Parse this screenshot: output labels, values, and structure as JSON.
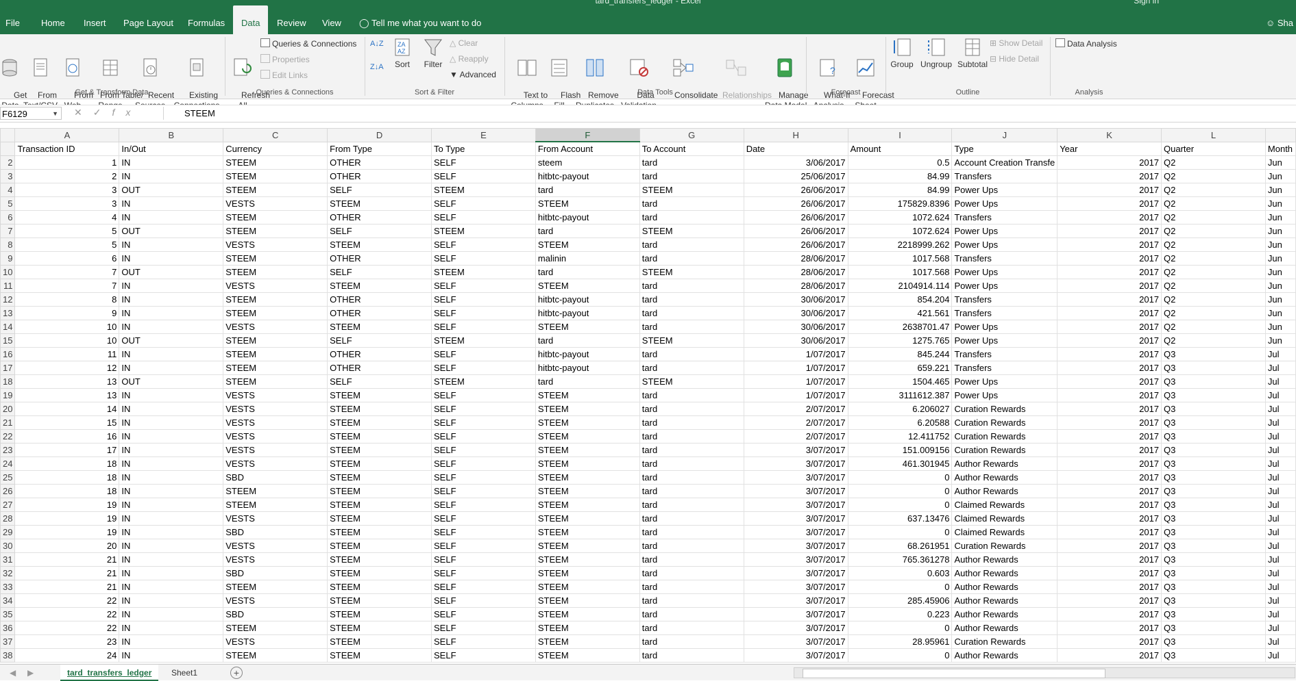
{
  "window": {
    "title": "tard_transfers_ledger  -  Excel",
    "sign_in": "Sign in",
    "share": "Sha"
  },
  "tabs": [
    "File",
    "Home",
    "Insert",
    "Page Layout",
    "Formulas",
    "Data",
    "Review",
    "View"
  ],
  "active_tab": "Data",
  "tell_me": "Tell me what you want to do",
  "ribbon": {
    "get_transform": {
      "label": "Get & Transform Data",
      "get_data": "Get\nData",
      "from_text": "From\nText/CSV",
      "from_web": "From\nWeb",
      "from_table": "From Table/\nRange",
      "recent_sources": "Recent\nSources",
      "existing_connections": "Existing\nConnections"
    },
    "queries": {
      "label": "Queries & Connections",
      "refresh_all": "Refresh\nAll",
      "queries_connections": "Queries & Connections",
      "properties": "Properties",
      "edit_links": "Edit Links"
    },
    "sort_filter": {
      "label": "Sort & Filter",
      "sort": "Sort",
      "filter": "Filter",
      "clear": "Clear",
      "reapply": "Reapply",
      "advanced": "Advanced"
    },
    "data_tools": {
      "label": "Data Tools",
      "text_to_columns": "Text to\nColumns",
      "flash_fill": "Flash\nFill",
      "remove_duplicates": "Remove\nDuplicates",
      "data_validation": "Data\nValidation",
      "consolidate": "Consolidate",
      "relationships": "Relationships",
      "manage_data_model": "Manage\nData Model"
    },
    "forecast": {
      "label": "Forecast",
      "what_if": "What-If\nAnalysis",
      "forecast_sheet": "Forecast\nSheet"
    },
    "outline": {
      "label": "Outline",
      "group": "Group",
      "ungroup": "Ungroup",
      "subtotal": "Subtotal",
      "show_detail": "Show Detail",
      "hide_detail": "Hide Detail"
    },
    "analysis": {
      "label": "Analysis",
      "data_analysis": "Data Analysis"
    }
  },
  "formula_bar": {
    "name_box": "F6129",
    "formula": "STEEM"
  },
  "columns": [
    "A",
    "B",
    "C",
    "D",
    "E",
    "F",
    "G",
    "H",
    "I",
    "J",
    "K",
    "L"
  ],
  "selected_column": "F",
  "headers": [
    "Transaction ID",
    "In/Out",
    "Currency",
    "From Type",
    "To Type",
    "From Account",
    "To Account",
    "Date",
    "Amount",
    "Type",
    "Year",
    "Quarter",
    "Month"
  ],
  "rows": [
    [
      "2",
      "1",
      "IN",
      "STEEM",
      "OTHER",
      "SELF",
      "steem",
      "tard",
      "3/06/2017",
      "0.5",
      "Account Creation Transfe",
      "2017",
      "Q2",
      "Jun"
    ],
    [
      "3",
      "2",
      "IN",
      "STEEM",
      "OTHER",
      "SELF",
      "hitbtc-payout",
      "tard",
      "25/06/2017",
      "84.99",
      "Transfers",
      "2017",
      "Q2",
      "Jun"
    ],
    [
      "4",
      "3",
      "OUT",
      "STEEM",
      "SELF",
      "STEEM",
      "tard",
      "STEEM",
      "26/06/2017",
      "84.99",
      "Power Ups",
      "2017",
      "Q2",
      "Jun"
    ],
    [
      "5",
      "3",
      "IN",
      "VESTS",
      "STEEM",
      "SELF",
      "STEEM",
      "tard",
      "26/06/2017",
      "175829.8396",
      "Power Ups",
      "2017",
      "Q2",
      "Jun"
    ],
    [
      "6",
      "4",
      "IN",
      "STEEM",
      "OTHER",
      "SELF",
      "hitbtc-payout",
      "tard",
      "26/06/2017",
      "1072.624",
      "Transfers",
      "2017",
      "Q2",
      "Jun"
    ],
    [
      "7",
      "5",
      "OUT",
      "STEEM",
      "SELF",
      "STEEM",
      "tard",
      "STEEM",
      "26/06/2017",
      "1072.624",
      "Power Ups",
      "2017",
      "Q2",
      "Jun"
    ],
    [
      "8",
      "5",
      "IN",
      "VESTS",
      "STEEM",
      "SELF",
      "STEEM",
      "tard",
      "26/06/2017",
      "2218999.262",
      "Power Ups",
      "2017",
      "Q2",
      "Jun"
    ],
    [
      "9",
      "6",
      "IN",
      "STEEM",
      "OTHER",
      "SELF",
      "malinin",
      "tard",
      "28/06/2017",
      "1017.568",
      "Transfers",
      "2017",
      "Q2",
      "Jun"
    ],
    [
      "10",
      "7",
      "OUT",
      "STEEM",
      "SELF",
      "STEEM",
      "tard",
      "STEEM",
      "28/06/2017",
      "1017.568",
      "Power Ups",
      "2017",
      "Q2",
      "Jun"
    ],
    [
      "11",
      "7",
      "IN",
      "VESTS",
      "STEEM",
      "SELF",
      "STEEM",
      "tard",
      "28/06/2017",
      "2104914.114",
      "Power Ups",
      "2017",
      "Q2",
      "Jun"
    ],
    [
      "12",
      "8",
      "IN",
      "STEEM",
      "OTHER",
      "SELF",
      "hitbtc-payout",
      "tard",
      "30/06/2017",
      "854.204",
      "Transfers",
      "2017",
      "Q2",
      "Jun"
    ],
    [
      "13",
      "9",
      "IN",
      "STEEM",
      "OTHER",
      "SELF",
      "hitbtc-payout",
      "tard",
      "30/06/2017",
      "421.561",
      "Transfers",
      "2017",
      "Q2",
      "Jun"
    ],
    [
      "14",
      "10",
      "IN",
      "VESTS",
      "STEEM",
      "SELF",
      "STEEM",
      "tard",
      "30/06/2017",
      "2638701.47",
      "Power Ups",
      "2017",
      "Q2",
      "Jun"
    ],
    [
      "15",
      "10",
      "OUT",
      "STEEM",
      "SELF",
      "STEEM",
      "tard",
      "STEEM",
      "30/06/2017",
      "1275.765",
      "Power Ups",
      "2017",
      "Q2",
      "Jun"
    ],
    [
      "16",
      "11",
      "IN",
      "STEEM",
      "OTHER",
      "SELF",
      "hitbtc-payout",
      "tard",
      "1/07/2017",
      "845.244",
      "Transfers",
      "2017",
      "Q3",
      "Jul"
    ],
    [
      "17",
      "12",
      "IN",
      "STEEM",
      "OTHER",
      "SELF",
      "hitbtc-payout",
      "tard",
      "1/07/2017",
      "659.221",
      "Transfers",
      "2017",
      "Q3",
      "Jul"
    ],
    [
      "18",
      "13",
      "OUT",
      "STEEM",
      "SELF",
      "STEEM",
      "tard",
      "STEEM",
      "1/07/2017",
      "1504.465",
      "Power Ups",
      "2017",
      "Q3",
      "Jul"
    ],
    [
      "19",
      "13",
      "IN",
      "VESTS",
      "STEEM",
      "SELF",
      "STEEM",
      "tard",
      "1/07/2017",
      "3111612.387",
      "Power Ups",
      "2017",
      "Q3",
      "Jul"
    ],
    [
      "20",
      "14",
      "IN",
      "VESTS",
      "STEEM",
      "SELF",
      "STEEM",
      "tard",
      "2/07/2017",
      "6.206027",
      "Curation Rewards",
      "2017",
      "Q3",
      "Jul"
    ],
    [
      "21",
      "15",
      "IN",
      "VESTS",
      "STEEM",
      "SELF",
      "STEEM",
      "tard",
      "2/07/2017",
      "6.20588",
      "Curation Rewards",
      "2017",
      "Q3",
      "Jul"
    ],
    [
      "22",
      "16",
      "IN",
      "VESTS",
      "STEEM",
      "SELF",
      "STEEM",
      "tard",
      "2/07/2017",
      "12.411752",
      "Curation Rewards",
      "2017",
      "Q3",
      "Jul"
    ],
    [
      "23",
      "17",
      "IN",
      "VESTS",
      "STEEM",
      "SELF",
      "STEEM",
      "tard",
      "3/07/2017",
      "151.009156",
      "Curation Rewards",
      "2017",
      "Q3",
      "Jul"
    ],
    [
      "24",
      "18",
      "IN",
      "VESTS",
      "STEEM",
      "SELF",
      "STEEM",
      "tard",
      "3/07/2017",
      "461.301945",
      "Author Rewards",
      "2017",
      "Q3",
      "Jul"
    ],
    [
      "25",
      "18",
      "IN",
      "SBD",
      "STEEM",
      "SELF",
      "STEEM",
      "tard",
      "3/07/2017",
      "0",
      "Author Rewards",
      "2017",
      "Q3",
      "Jul"
    ],
    [
      "26",
      "18",
      "IN",
      "STEEM",
      "STEEM",
      "SELF",
      "STEEM",
      "tard",
      "3/07/2017",
      "0",
      "Author Rewards",
      "2017",
      "Q3",
      "Jul"
    ],
    [
      "27",
      "19",
      "IN",
      "STEEM",
      "STEEM",
      "SELF",
      "STEEM",
      "tard",
      "3/07/2017",
      "0",
      "Claimed Rewards",
      "2017",
      "Q3",
      "Jul"
    ],
    [
      "28",
      "19",
      "IN",
      "VESTS",
      "STEEM",
      "SELF",
      "STEEM",
      "tard",
      "3/07/2017",
      "637.13476",
      "Claimed Rewards",
      "2017",
      "Q3",
      "Jul"
    ],
    [
      "29",
      "19",
      "IN",
      "SBD",
      "STEEM",
      "SELF",
      "STEEM",
      "tard",
      "3/07/2017",
      "0",
      "Claimed Rewards",
      "2017",
      "Q3",
      "Jul"
    ],
    [
      "30",
      "20",
      "IN",
      "VESTS",
      "STEEM",
      "SELF",
      "STEEM",
      "tard",
      "3/07/2017",
      "68.261951",
      "Curation Rewards",
      "2017",
      "Q3",
      "Jul"
    ],
    [
      "31",
      "21",
      "IN",
      "VESTS",
      "STEEM",
      "SELF",
      "STEEM",
      "tard",
      "3/07/2017",
      "765.361278",
      "Author Rewards",
      "2017",
      "Q3",
      "Jul"
    ],
    [
      "32",
      "21",
      "IN",
      "SBD",
      "STEEM",
      "SELF",
      "STEEM",
      "tard",
      "3/07/2017",
      "0.603",
      "Author Rewards",
      "2017",
      "Q3",
      "Jul"
    ],
    [
      "33",
      "21",
      "IN",
      "STEEM",
      "STEEM",
      "SELF",
      "STEEM",
      "tard",
      "3/07/2017",
      "0",
      "Author Rewards",
      "2017",
      "Q3",
      "Jul"
    ],
    [
      "34",
      "22",
      "IN",
      "VESTS",
      "STEEM",
      "SELF",
      "STEEM",
      "tard",
      "3/07/2017",
      "285.45906",
      "Author Rewards",
      "2017",
      "Q3",
      "Jul"
    ],
    [
      "35",
      "22",
      "IN",
      "SBD",
      "STEEM",
      "SELF",
      "STEEM",
      "tard",
      "3/07/2017",
      "0.223",
      "Author Rewards",
      "2017",
      "Q3",
      "Jul"
    ],
    [
      "36",
      "22",
      "IN",
      "STEEM",
      "STEEM",
      "SELF",
      "STEEM",
      "tard",
      "3/07/2017",
      "0",
      "Author Rewards",
      "2017",
      "Q3",
      "Jul"
    ],
    [
      "37",
      "23",
      "IN",
      "VESTS",
      "STEEM",
      "SELF",
      "STEEM",
      "tard",
      "3/07/2017",
      "28.95961",
      "Curation Rewards",
      "2017",
      "Q3",
      "Jul"
    ],
    [
      "38",
      "24",
      "IN",
      "STEEM",
      "STEEM",
      "SELF",
      "STEEM",
      "tard",
      "3/07/2017",
      "0",
      "Author Rewards",
      "2017",
      "Q3",
      "Jul"
    ]
  ],
  "sheets": [
    "tard_transfers_ledger",
    "Sheet1"
  ],
  "active_sheet": "tard_transfers_ledger",
  "colors": {
    "accent": "#217346",
    "ribbon_bg": "#f3f3f3"
  }
}
